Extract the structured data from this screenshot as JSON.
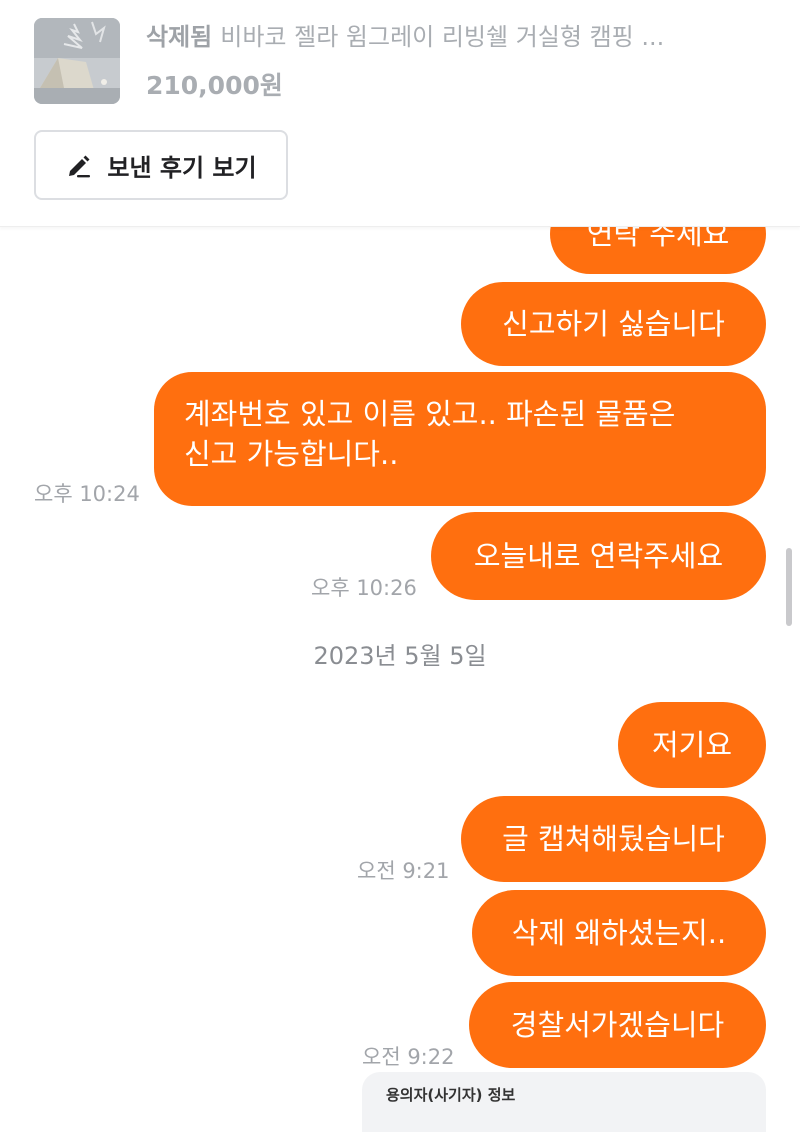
{
  "product": {
    "status": "삭제됨",
    "title": "비바코 젤라 윔그레이 리빙쉘 거실형 캠핑 ...",
    "price": "210,000원",
    "thumbnail_icon": "tent-photo-thumbnail"
  },
  "review_button": {
    "label": "보낸 후기 보기",
    "icon": "pencil-icon"
  },
  "messages": [
    {
      "text": "연락 주세요",
      "time": ""
    },
    {
      "text": "신고하기 싫습니다",
      "time": ""
    },
    {
      "lines": [
        "계좌번호 있고 이름 있고.. 파손된 물품은",
        "신고 가능합니다.."
      ],
      "time": "오후 10:24"
    },
    {
      "text": "오늘내로 연락주세요",
      "time": "오후 10:26"
    },
    {
      "text": "저기요",
      "time": ""
    },
    {
      "text": "글 캡쳐해뒀습니다",
      "time": "오전 9:21"
    },
    {
      "text": "삭제 왜하셨는지..",
      "time": ""
    },
    {
      "text": "경찰서가겠습니다",
      "time": "오전 9:22"
    }
  ],
  "date_separator": "2023년 5월 5일",
  "attachment": {
    "label": "용의자(사기자) 정보"
  },
  "colors": {
    "bubble": "#ff6f0f",
    "bubble_text": "#ffffff"
  }
}
